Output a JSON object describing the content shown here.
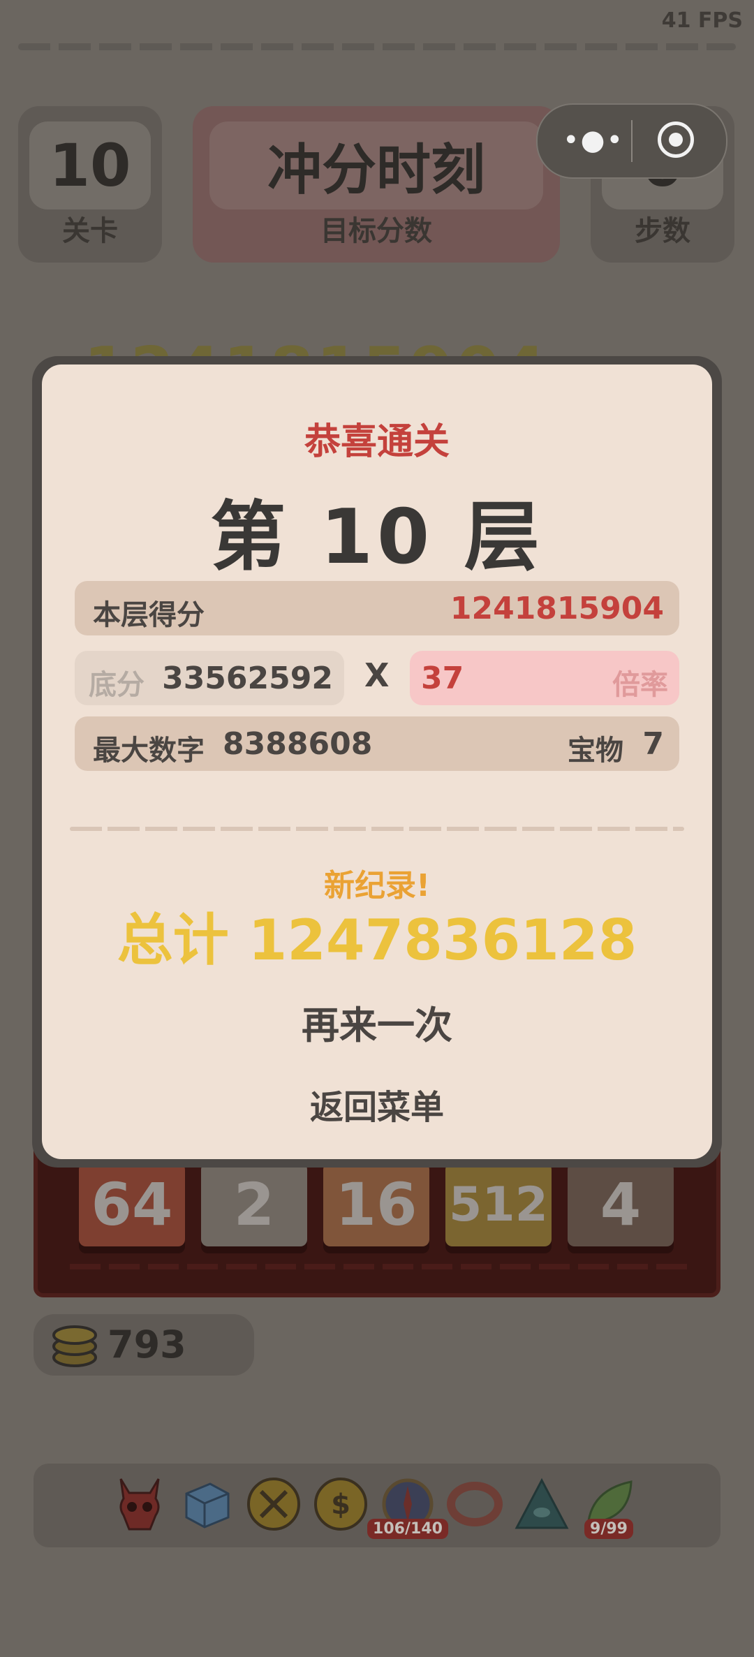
{
  "fps": "41 FPS",
  "header": {
    "level": {
      "value": "10",
      "label": "关卡"
    },
    "target": {
      "value": "冲分时刻",
      "label": "目标分数"
    },
    "steps": {
      "value": "0",
      "label": "步数"
    }
  },
  "capsule": {
    "more_icon": "more-dots-icon",
    "close_icon": "target-circle-icon"
  },
  "background_score": "1241815904",
  "board_tiles": [
    "64",
    "2",
    "16",
    "512",
    "4"
  ],
  "coins": "793",
  "inventory": [
    {
      "icon": "demon-skull-icon",
      "badge": ""
    },
    {
      "icon": "ice-cube-icon",
      "badge": ""
    },
    {
      "icon": "crossed-swords-coin-icon",
      "badge": ""
    },
    {
      "icon": "dollar-coin-icon",
      "badge": ""
    },
    {
      "icon": "compass-icon",
      "badge": "106/140"
    },
    {
      "icon": "ring-icon",
      "badge": ""
    },
    {
      "icon": "eye-pyramid-icon",
      "badge": ""
    },
    {
      "icon": "leaf-icon",
      "badge": "9/99"
    }
  ],
  "modal": {
    "congrats": "恭喜通关",
    "floor_title": "第 10 层",
    "floor_score_label": "本层得分",
    "floor_score_value": "1241815904",
    "base_label": "底分",
    "base_value": "33562592",
    "times": "X",
    "multiplier_value": "37",
    "multiplier_label": "倍率",
    "max_number_label": "最大数字",
    "max_number_value": "8388608",
    "treasure_label": "宝物",
    "treasure_value": "7",
    "new_record": "新纪录!",
    "total": "总计 1247836128",
    "play_again": "再来一次",
    "back_to_menu": "返回菜单"
  },
  "colors": {
    "modal_bg": "#f0e1d5",
    "accent_red": "#c4413c",
    "gold": "#ecc23d",
    "orange": "#eaa234"
  }
}
